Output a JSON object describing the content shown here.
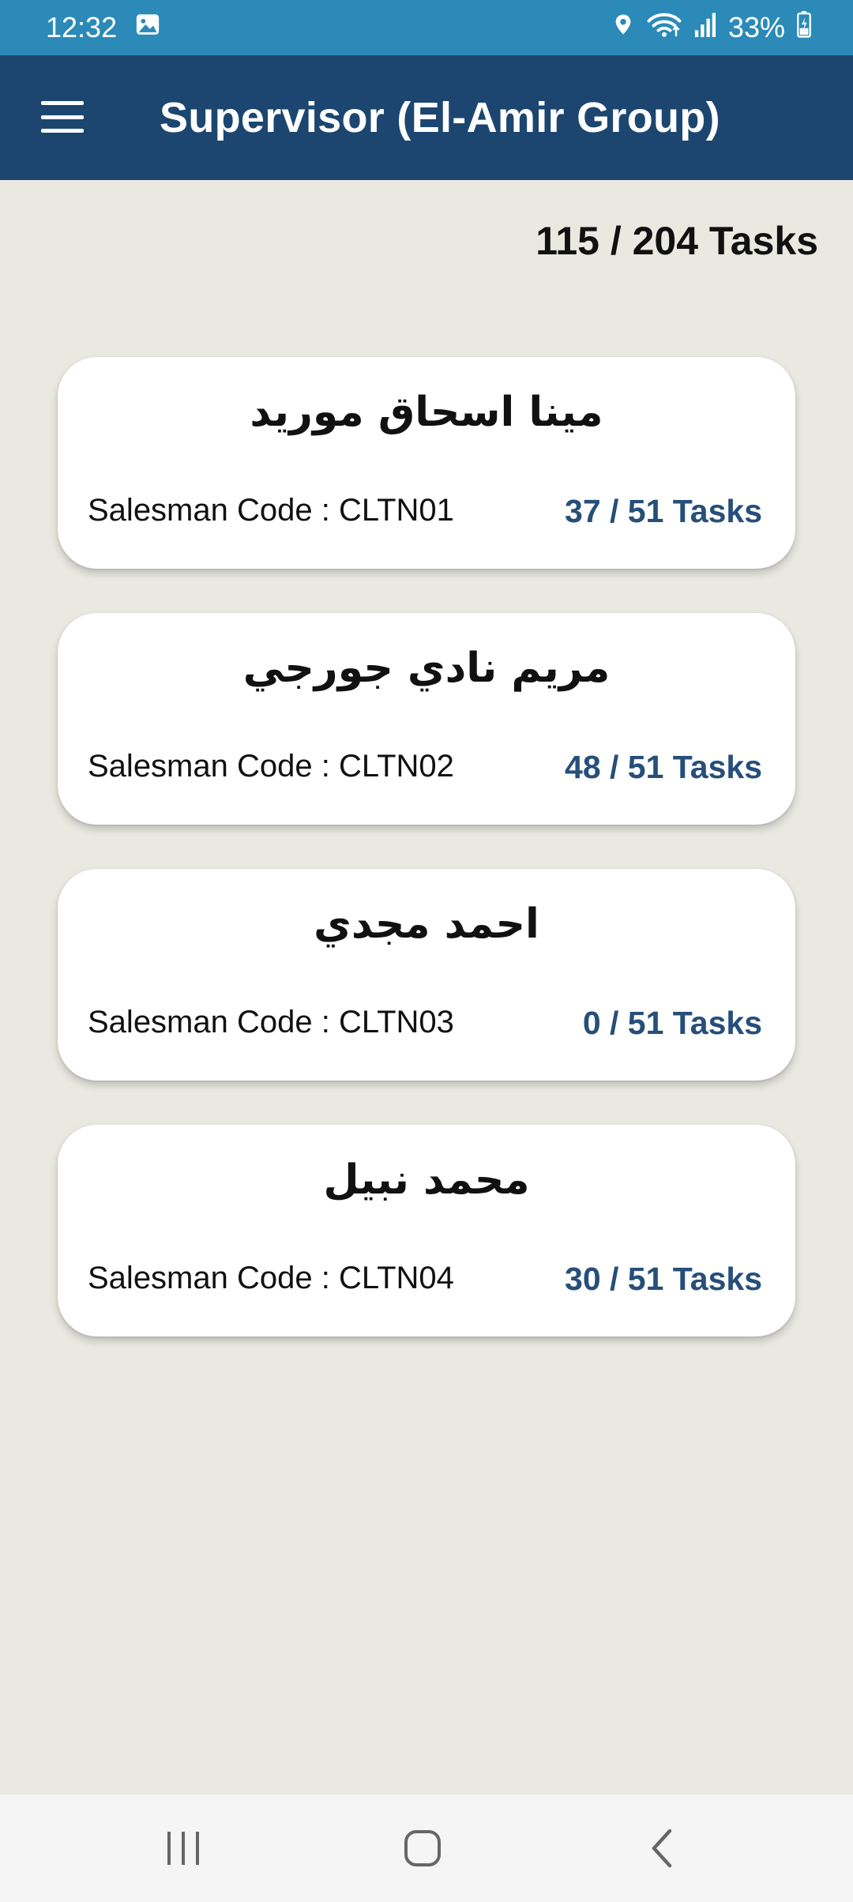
{
  "status_bar": {
    "time": "12:32",
    "battery": "33%",
    "icons": [
      "image-icon",
      "location-icon",
      "wifi-icon",
      "signal-icon",
      "battery-icon"
    ]
  },
  "app_bar": {
    "title": "Supervisor (El-Amir Group)",
    "menu_icon": "hamburger-menu-icon"
  },
  "summary": {
    "total_tasks": "115 / 204 Tasks"
  },
  "salesmen": [
    {
      "name": "مينا اسحاق موريد",
      "code_label": "Salesman Code : CLTN01",
      "tasks": "37 / 51 Tasks"
    },
    {
      "name": "مريم نادي جورجي",
      "code_label": "Salesman Code : CLTN02",
      "tasks": "48 / 51 Tasks"
    },
    {
      "name": "احمد مجدي",
      "code_label": "Salesman Code : CLTN03",
      "tasks": "0 / 51 Tasks"
    },
    {
      "name": "محمد نبيل",
      "code_label": "Salesman Code : CLTN04",
      "tasks": "30 / 51 Tasks"
    }
  ],
  "navigation": {
    "buttons": [
      "recent-apps-icon",
      "home-icon",
      "back-icon"
    ]
  },
  "colors": {
    "status_bar": "#2b8ab8",
    "app_bar": "#1c4670",
    "background": "#e9e9e2",
    "task_count": "#264f79"
  }
}
